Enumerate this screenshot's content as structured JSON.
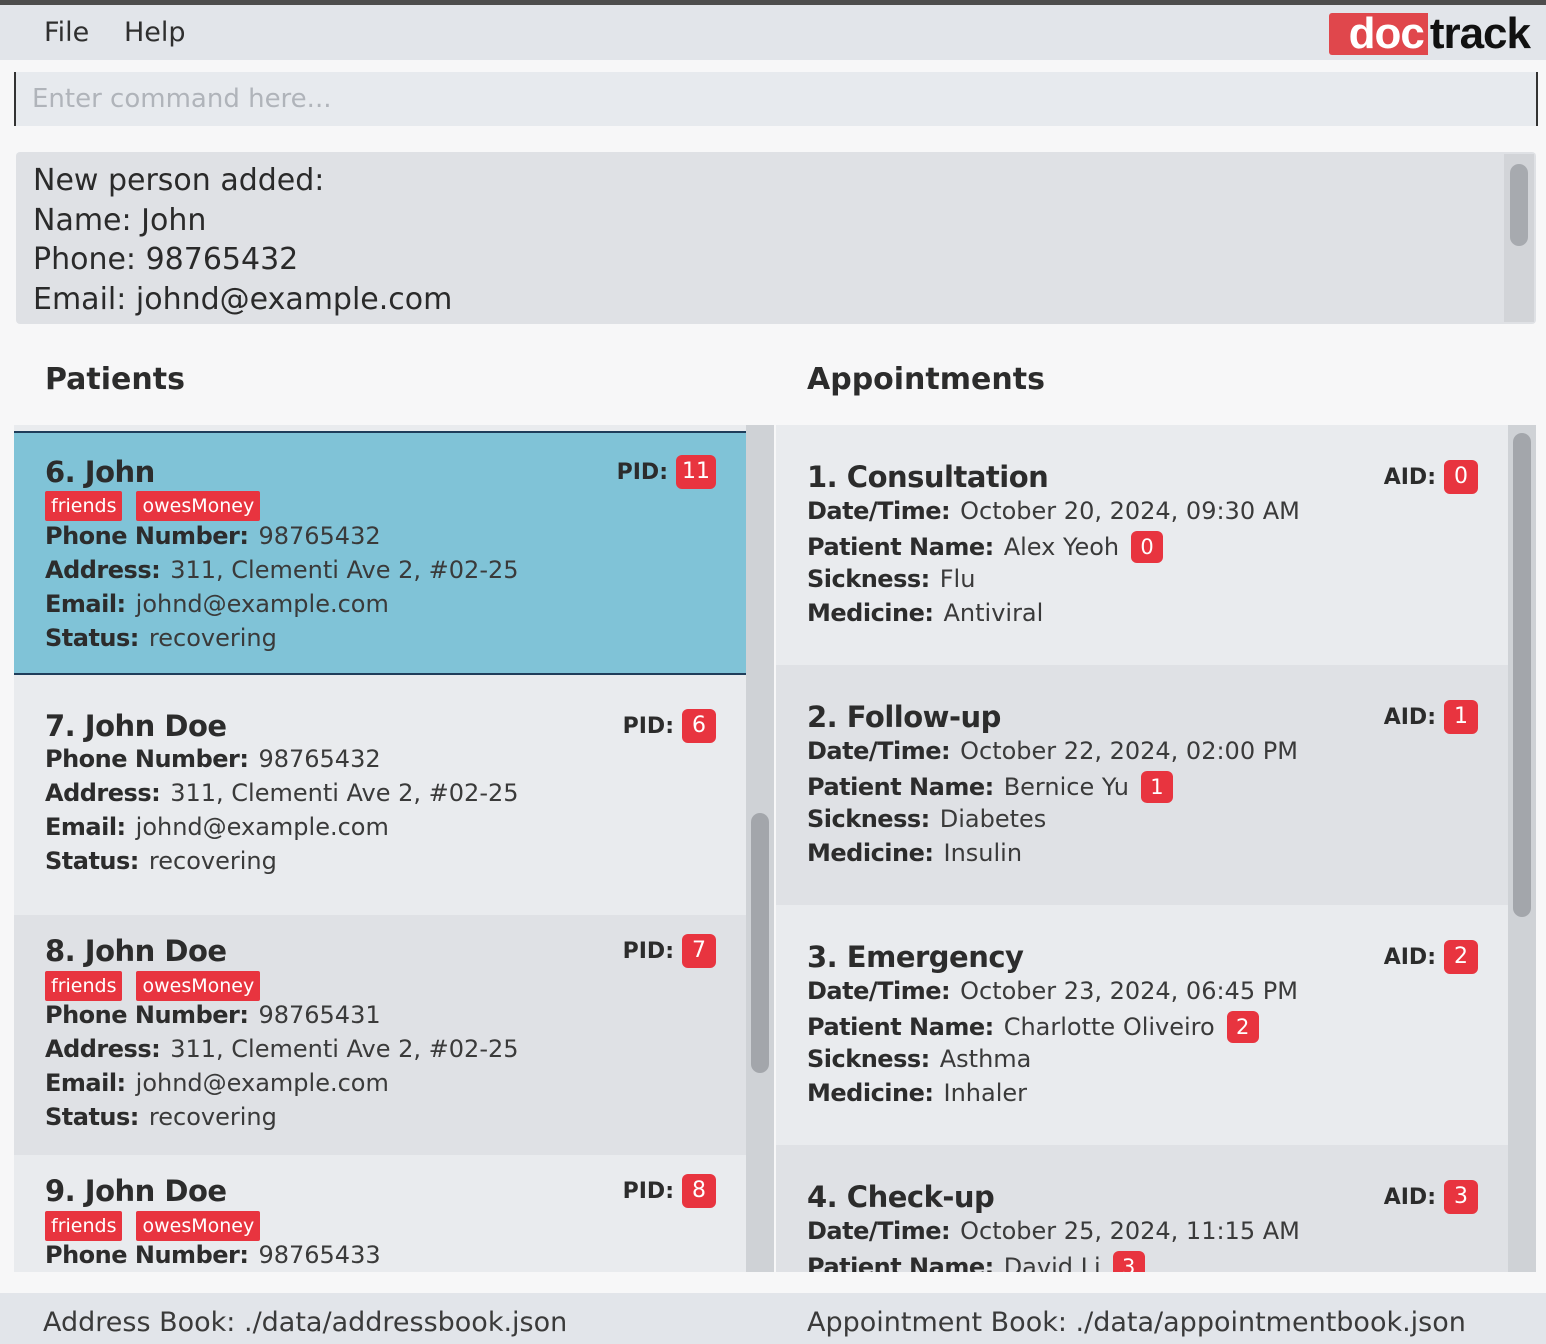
{
  "menu": {
    "file": "File",
    "help": "Help"
  },
  "logo": {
    "part1": "doc",
    "part2": "track"
  },
  "command": {
    "placeholder": "Enter command here...",
    "value": ""
  },
  "result": {
    "lines": [
      "New person added:",
      "Name: John",
      "Phone: 98765432",
      "Email: johnd@example.com"
    ]
  },
  "patients_title": "Patients",
  "appointments_title": "Appointments",
  "patients": [
    {
      "title": "6. John",
      "pid_label": "PID:",
      "pid": "11",
      "tags": [
        "friends",
        "owesMoney"
      ],
      "phone_label": "Phone Number:",
      "phone": "98765432",
      "address_label": "Address:",
      "address": "311, Clementi Ave 2, #02-25",
      "email_label": "Email:",
      "email": "johnd@example.com",
      "status_label": "Status:",
      "status": "recovering"
    },
    {
      "title": "7. John Doe",
      "pid_label": "PID:",
      "pid": "6",
      "tags": [],
      "phone_label": "Phone Number:",
      "phone": "98765432",
      "address_label": "Address:",
      "address": "311, Clementi Ave 2, #02-25",
      "email_label": "Email:",
      "email": "johnd@example.com",
      "status_label": "Status:",
      "status": "recovering"
    },
    {
      "title": "8. John Doe",
      "pid_label": "PID:",
      "pid": "7",
      "tags": [
        "friends",
        "owesMoney"
      ],
      "phone_label": "Phone Number:",
      "phone": "98765431",
      "address_label": "Address:",
      "address": "311, Clementi Ave 2, #02-25",
      "email_label": "Email:",
      "email": "johnd@example.com",
      "status_label": "Status:",
      "status": "recovering"
    },
    {
      "title": "9. John Doe",
      "pid_label": "PID:",
      "pid": "8",
      "tags": [
        "friends",
        "owesMoney"
      ],
      "phone_label": "Phone Number:",
      "phone": "98765433"
    }
  ],
  "appointments": [
    {
      "title": "1. Consultation",
      "aid_label": "AID:",
      "aid": "0",
      "datetime_label": "Date/Time:",
      "datetime": "October 20, 2024, 09:30 AM",
      "patient_label": "Patient Name:",
      "patient": "Alex Yeoh",
      "patient_id": "0",
      "sickness_label": "Sickness:",
      "sickness": "Flu",
      "medicine_label": "Medicine:",
      "medicine": "Antiviral"
    },
    {
      "title": "2. Follow-up",
      "aid_label": "AID:",
      "aid": "1",
      "datetime_label": "Date/Time:",
      "datetime": "October 22, 2024, 02:00 PM",
      "patient_label": "Patient Name:",
      "patient": "Bernice Yu",
      "patient_id": "1",
      "sickness_label": "Sickness:",
      "sickness": "Diabetes",
      "medicine_label": "Medicine:",
      "medicine": "Insulin"
    },
    {
      "title": "3. Emergency",
      "aid_label": "AID:",
      "aid": "2",
      "datetime_label": "Date/Time:",
      "datetime": "October 23, 2024, 06:45 PM",
      "patient_label": "Patient Name:",
      "patient": "Charlotte Oliveiro",
      "patient_id": "2",
      "sickness_label": "Sickness:",
      "sickness": "Asthma",
      "medicine_label": "Medicine:",
      "medicine": "Inhaler"
    },
    {
      "title": "4. Check-up",
      "aid_label": "AID:",
      "aid": "3",
      "datetime_label": "Date/Time:",
      "datetime": "October 25, 2024, 11:15 AM",
      "patient_label": "Patient Name:",
      "patient": "David Li",
      "patient_id": "3"
    }
  ],
  "status": {
    "address_book": "Address Book: ./data/addressbook.json",
    "appointment_book": "Appointment Book: ./data/appointmentbook.json"
  }
}
